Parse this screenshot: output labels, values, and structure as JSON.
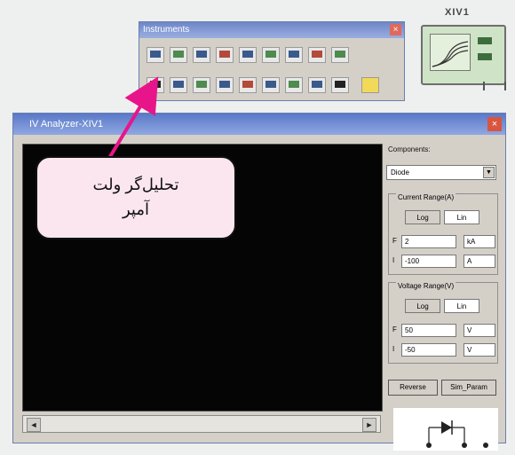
{
  "instruments_palette": {
    "title": "Instruments",
    "close_glyph": "×",
    "row1_icons": [
      "multimeter-icon",
      "function-generator-icon",
      "wattmeter-icon",
      "oscilloscope-icon",
      "four-channel-oscilloscope-icon",
      "bode-plotter-icon",
      "frequency-counter-icon",
      "word-generator-icon",
      "logic-analyzer-icon"
    ],
    "row2_icons": [
      "iv-analyzer-icon",
      "distortion-analyzer-icon",
      "spectrum-analyzer-icon",
      "network-analyzer-icon",
      "agilent-generator-icon",
      "agilent-multimeter-icon",
      "agilent-oscilloscope-icon",
      "tektronix-oscilloscope-icon",
      "measurement-probe-icon",
      "labview-icon"
    ]
  },
  "device": {
    "label": "XIV1"
  },
  "window": {
    "title": "IV Analyzer-XIV1",
    "close_glyph": "×"
  },
  "panel": {
    "components_label": "Components:",
    "component_value": "Diode",
    "current_range_label": "Current Range(A)",
    "current": {
      "log_label": "Log",
      "lin_label": "Lin",
      "f_key": "F",
      "f_value": "2",
      "f_unit": "kA",
      "i_key": "I",
      "i_value": "-100",
      "i_unit": "A"
    },
    "voltage_range_label": "Voltage Range(V)",
    "voltage": {
      "log_label": "Log",
      "lin_label": "Lin",
      "f_key": "F",
      "f_value": "50",
      "f_unit": "V",
      "i_key": "I",
      "i_value": "-50",
      "i_unit": "V"
    },
    "reverse_label": "Reverse",
    "sim_param_label": "Sim_Param",
    "diode_symbol": "diode-symbol-icon"
  },
  "scroll": {
    "left_glyph": "◄",
    "right_glyph": "►"
  },
  "callout": {
    "line1": "تحلیل‌گر ولت",
    "line2": "آمپر"
  },
  "colors": {
    "screen": "#050505",
    "title_bar": "#5a78c8",
    "callout_fill": "#fbe6f0",
    "arrow": "#e8158a"
  }
}
